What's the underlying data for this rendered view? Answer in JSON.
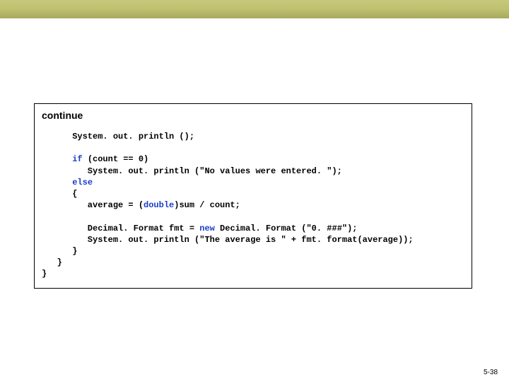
{
  "top_bar": {
    "present": true
  },
  "code_panel": {
    "title": "continue",
    "lines": {
      "l1": "      System. out. println ();",
      "l2": "",
      "l3a": "      ",
      "l3_kw": "if",
      "l3b": " (count == 0)",
      "l4": "         System. out. println (\"No values were entered. \");",
      "l5a": "      ",
      "l5_kw": "else",
      "l6": "      {",
      "l7a": "         average = (",
      "l7_kw": "double",
      "l7b": ")sum / count;",
      "l8": "",
      "l9a": "         Decimal. Format fmt = ",
      "l9_kw": "new",
      "l9b": " Decimal. Format (\"0. ###\");",
      "l10": "         System. out. println (\"The average is \" + fmt. format(average));",
      "l11": "      }",
      "l12": "   }",
      "l13": "}"
    }
  },
  "page_number": "5-38"
}
